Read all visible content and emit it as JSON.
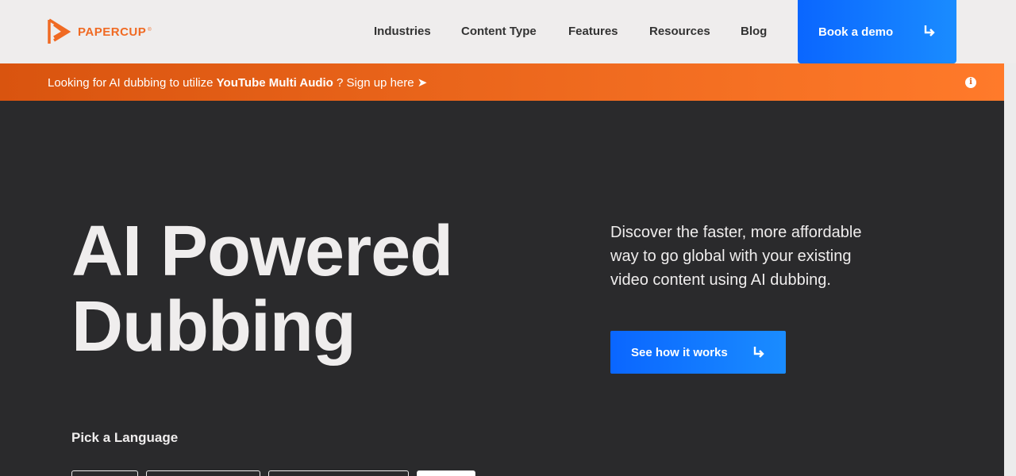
{
  "header": {
    "logo_text": "PAPERCUP",
    "logo_tm": "®",
    "nav": [
      "Industries",
      "Content Type",
      "Features",
      "Resources",
      "Blog"
    ],
    "demo_label": "Book a demo"
  },
  "banner": {
    "prefix": "Looking for AI dubbing to utilize ",
    "highlight": "YouTube Multi Audio",
    "suffix": " ? Sign up here ➤"
  },
  "hero": {
    "title_line1": "AI Powered",
    "title_line2": "Dubbing",
    "description": "Discover the faster, more affordable way to go global with your existing video content using AI dubbing.",
    "cta_label": "See how it works",
    "pick_label": "Pick a Language"
  },
  "colors": {
    "brand_orange": "#f06a23",
    "accent_blue": "#0a66ff",
    "dark_bg": "#2a2a2c"
  }
}
